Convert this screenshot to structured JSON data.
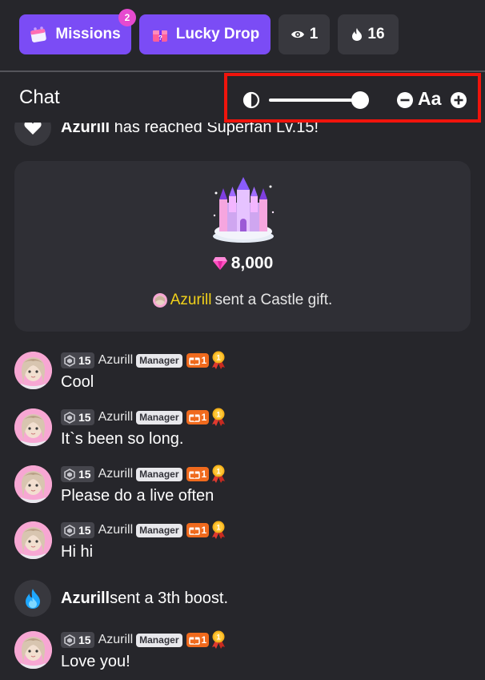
{
  "header": {
    "missions_label": "Missions",
    "missions_badge": "2",
    "lucky_drop_label": "Lucky Drop",
    "viewers_count": "1",
    "fire_count": "16"
  },
  "chat": {
    "title": "Chat",
    "font_size_label": "Aa"
  },
  "system_top": {
    "user": "Azurill",
    "text": " has reached Superfan Lv.15!"
  },
  "gift": {
    "amount": "8,000",
    "sender": "Azurill",
    "text": "sent a Castle gift."
  },
  "messages": [
    {
      "level": "15",
      "user": "Azurill",
      "role": "Manager",
      "gift_count": "1",
      "text": "Cool"
    },
    {
      "level": "15",
      "user": "Azurill",
      "role": "Manager",
      "gift_count": "1",
      "text": "It`s been so long."
    },
    {
      "level": "15",
      "user": "Azurill",
      "role": "Manager",
      "gift_count": "1",
      "text": "Please do a live often"
    },
    {
      "level": "15",
      "user": "Azurill",
      "role": "Manager",
      "gift_count": "1",
      "text": "Hi hi"
    },
    {
      "level": "15",
      "user": "Azurill",
      "role": "Manager",
      "gift_count": "1",
      "text": "Love you!"
    }
  ],
  "boost": {
    "user": "Azurill",
    "text": "sent a 3th boost."
  },
  "colors": {
    "background": "#26262b",
    "accent_purple": "#7b4cf5",
    "highlight_border": "#f0140c",
    "sender_yellow": "#f2d21a"
  },
  "icons": {
    "missions": "calendar-icon",
    "lucky_drop": "gift-box-icon",
    "viewers": "eye-icon",
    "fire": "fire-icon",
    "contrast": "contrast-icon",
    "decrease": "minus-circle-icon",
    "increase": "plus-circle-icon",
    "boost": "blue-flame-icon"
  }
}
